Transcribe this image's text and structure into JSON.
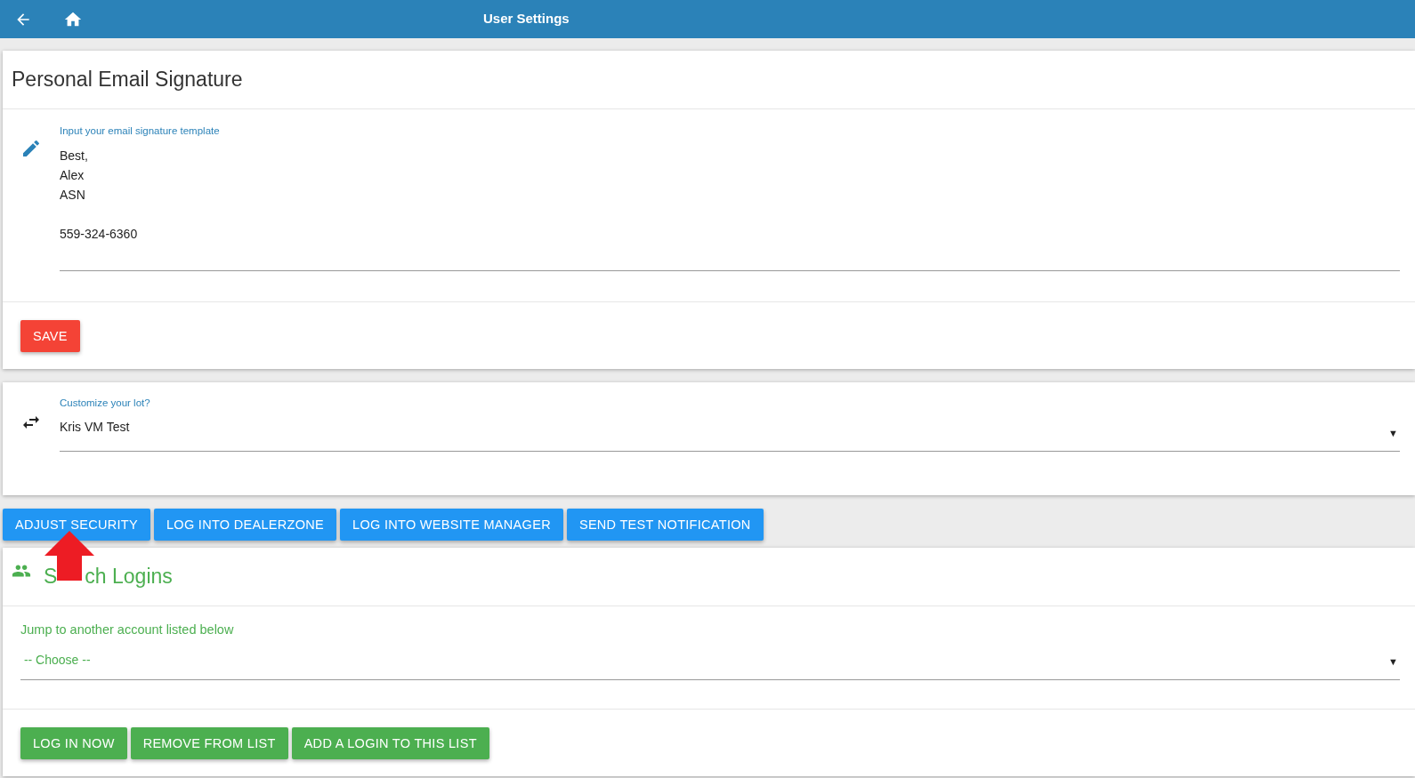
{
  "header": {
    "title": "User Settings"
  },
  "signature_card": {
    "title": "Personal Email Signature",
    "field": {
      "label": "Input your email signature template",
      "value": "Best,\nAlex\nASN\n\n559-324-6360"
    },
    "save_button": "SAVE"
  },
  "lot_card": {
    "field": {
      "label": "Customize your lot?",
      "value": "Kris VM Test",
      "caret": "▼"
    }
  },
  "action_buttons": [
    "ADJUST SECURITY",
    "LOG INTO DEALERZONE",
    "LOG INTO WEBSITE MANAGER",
    "SEND TEST NOTIFICATION"
  ],
  "switch_card": {
    "title_parts": [
      "S",
      "ch Logins"
    ],
    "field": {
      "label": "Jump to another account listed below",
      "value": "-- Choose --",
      "caret": "▼"
    },
    "buttons": [
      "LOG IN NOW",
      "REMOVE FROM LIST",
      "ADD A LOGIN TO THIS LIST"
    ]
  },
  "annotation": {
    "kind": "arrow",
    "color": "#ed1c24"
  }
}
